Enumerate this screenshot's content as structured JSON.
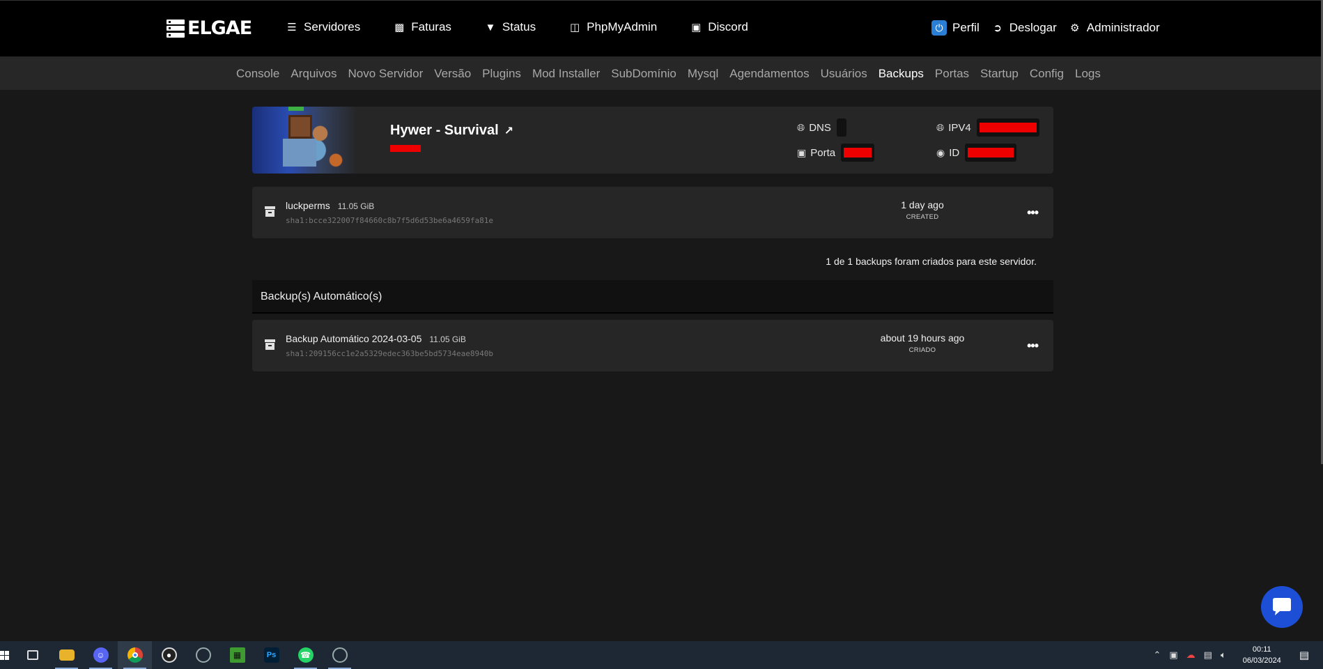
{
  "topnav": {
    "logo_text": "ELGAE",
    "left_items": [
      {
        "label": "Servidores",
        "icon": "server-icon"
      },
      {
        "label": "Faturas",
        "icon": "money-icon"
      },
      {
        "label": "Status",
        "icon": "wifi-icon"
      },
      {
        "label": "PhpMyAdmin",
        "icon": "database-icon"
      },
      {
        "label": "Discord",
        "icon": "discord-icon"
      }
    ],
    "right_items": [
      {
        "label": "Perfil",
        "icon": "power-icon"
      },
      {
        "label": "Deslogar",
        "icon": "sign-out-icon"
      },
      {
        "label": "Administrador",
        "icon": "cogs-icon"
      }
    ]
  },
  "subnav": {
    "items": [
      "Console",
      "Arquivos",
      "Novo Servidor",
      "Versão",
      "Plugins",
      "Mod Installer",
      "SubDomínio",
      "Mysql",
      "Agendamentos",
      "Usuários",
      "Backups",
      "Portas",
      "Startup",
      "Config",
      "Logs"
    ],
    "active": "Backups"
  },
  "server": {
    "name": "Hywer - Survival",
    "dns_label": "DNS",
    "port_label": "Porta",
    "ipv4_label": "IPV4",
    "id_label": "ID",
    "redaction_color": "#ee0000"
  },
  "backups": [
    {
      "name": "luckperms",
      "size": "11.05 GiB",
      "hash": "sha1:bcce322007f84660c8b7f5d6d53be6a4659fa81e",
      "time": "1 day ago",
      "status": "CREATED"
    }
  ],
  "backup_count_text": "1 de 1 backups foram criados para este servidor.",
  "auto_section": {
    "title": "Backup(s) Automático(s)",
    "items": [
      {
        "name": "Backup Automático 2024-03-05",
        "size": "11.05 GiB",
        "hash": "sha1:209156cc1e2a5329edec363be5bd5734eae8940b",
        "time": "about 19 hours ago",
        "status": "CRIADO"
      }
    ]
  },
  "taskbar": {
    "apps": [
      "windows-start",
      "task-view",
      "file-explorer",
      "discord",
      "chrome",
      "obs",
      "app-circle-1",
      "minecraft",
      "photoshop",
      "whatsapp",
      "app-circle-2"
    ],
    "clock_time": "00:11",
    "clock_date": "06/03/2024"
  }
}
